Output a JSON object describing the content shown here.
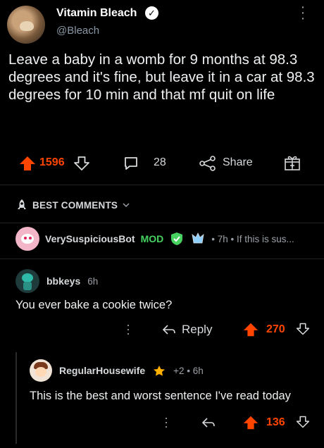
{
  "tweet": {
    "name": "Vitamin Bleach",
    "handle": "@Bleach",
    "text": "Leave a baby in a womb for 9 months at 98.3 degrees and it's fine, but leave it in a car at 98.3 degrees for 10 min and that mf quit on life"
  },
  "post_actions": {
    "upvotes": "1596",
    "comments": "28",
    "share_label": "Share"
  },
  "section": {
    "best_comments": "BEST COMMENTS"
  },
  "bot_comment": {
    "username": "VerySuspiciousBot",
    "mod": "MOD",
    "meta": "• 7h • If this is sus..."
  },
  "comment1": {
    "username": "bbkeys",
    "time": "6h",
    "text": "You ever bake a cookie twice?",
    "reply_label": "Reply",
    "votes": "270"
  },
  "comment2": {
    "username": "RegularHousewife",
    "meta": "+2 • 6h",
    "text": "This is the best and worst sentence I've read today",
    "votes": "136"
  },
  "colors": {
    "upvote": "#ff4500",
    "mod": "#46d160",
    "background": "#000000",
    "text": "#d7dadc"
  }
}
